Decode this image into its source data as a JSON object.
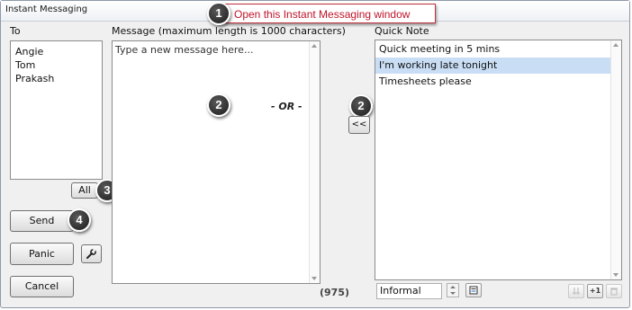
{
  "window": {
    "title": "Instant Messaging"
  },
  "callout": {
    "badge": "1",
    "text": "Open this Instant Messaging window"
  },
  "to": {
    "label": "To",
    "recipients": [
      "Angie",
      "Tom",
      "Prakash"
    ],
    "all_button": "All",
    "badge": "3"
  },
  "message": {
    "label": "Message (maximum length is 1000 characters)",
    "placeholder": "Type a new message here...",
    "or_text": "- OR -",
    "badge": "2",
    "char_count": "(975)"
  },
  "quick_note": {
    "label": "Quick Note",
    "items": [
      "Quick meeting in 5 mins",
      "I'm working late tonight",
      "Timesheets please"
    ],
    "selected_index": 1,
    "insert_button": "<<",
    "insert_badge": "2",
    "tone_value": "Informal",
    "edit_icon": "edit-note-icon",
    "add_label": "+1"
  },
  "buttons": {
    "send": "Send",
    "send_badge": "4",
    "panic": "Panic",
    "settings_icon": "wrench-icon",
    "cancel": "Cancel"
  },
  "colors": {
    "callout_border": "#c0303a",
    "callout_text": "#c0142a",
    "selected_bg": "#c9def5"
  }
}
